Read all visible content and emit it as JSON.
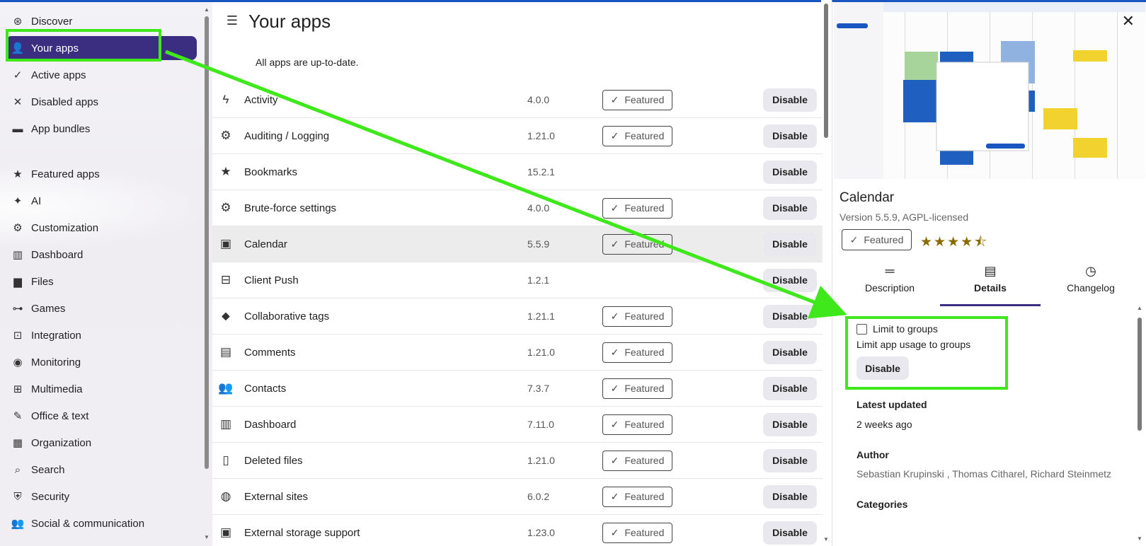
{
  "sidebar": {
    "items": [
      {
        "label": "Discover",
        "icon": "compass-icon",
        "active": false
      },
      {
        "label": "Your apps",
        "icon": "user-icon",
        "active": true
      },
      {
        "label": "Active apps",
        "icon": "check-icon",
        "active": false
      },
      {
        "label": "Disabled apps",
        "icon": "close-icon",
        "active": false
      },
      {
        "label": "App bundles",
        "icon": "archive-icon",
        "active": false
      }
    ],
    "categories": [
      {
        "label": "Featured apps",
        "icon": "star-icon"
      },
      {
        "label": "AI",
        "icon": "sparkle-icon"
      },
      {
        "label": "Customization",
        "icon": "gear-icon"
      },
      {
        "label": "Dashboard",
        "icon": "dashboard-icon"
      },
      {
        "label": "Files",
        "icon": "folder-icon"
      },
      {
        "label": "Games",
        "icon": "gamepad-icon"
      },
      {
        "label": "Integration",
        "icon": "integration-icon"
      },
      {
        "label": "Monitoring",
        "icon": "monitor-icon"
      },
      {
        "label": "Multimedia",
        "icon": "multimedia-icon"
      },
      {
        "label": "Office & text",
        "icon": "document-edit-icon"
      },
      {
        "label": "Organization",
        "icon": "building-icon"
      },
      {
        "label": "Search",
        "icon": "search-icon"
      },
      {
        "label": "Security",
        "icon": "shield-icon"
      },
      {
        "label": "Social & communication",
        "icon": "people-icon"
      }
    ]
  },
  "main": {
    "title": "Your apps",
    "status": "All apps are up-to-date.",
    "featured_label": "Featured",
    "disable_label": "Disable",
    "apps": [
      {
        "name": "Activity",
        "version": "4.0.0",
        "featured": true,
        "icon": "lightning-icon"
      },
      {
        "name": "Auditing / Logging",
        "version": "1.21.0",
        "featured": true,
        "icon": "gear-icon"
      },
      {
        "name": "Bookmarks",
        "version": "15.2.1",
        "featured": false,
        "icon": "star-icon"
      },
      {
        "name": "Brute-force settings",
        "version": "4.0.0",
        "featured": true,
        "icon": "gear-icon"
      },
      {
        "name": "Calendar",
        "version": "5.5.9",
        "featured": true,
        "icon": "calendar-icon",
        "selected": true
      },
      {
        "name": "Client Push",
        "version": "1.2.1",
        "featured": false,
        "icon": "push-icon"
      },
      {
        "name": "Collaborative tags",
        "version": "1.21.1",
        "featured": true,
        "icon": "tag-icon"
      },
      {
        "name": "Comments",
        "version": "1.21.0",
        "featured": true,
        "icon": "comment-icon"
      },
      {
        "name": "Contacts",
        "version": "7.3.7",
        "featured": true,
        "icon": "contacts-icon"
      },
      {
        "name": "Dashboard",
        "version": "7.11.0",
        "featured": true,
        "icon": "dashboard-icon"
      },
      {
        "name": "Deleted files",
        "version": "1.21.0",
        "featured": true,
        "icon": "trash-icon"
      },
      {
        "name": "External sites",
        "version": "6.0.2",
        "featured": true,
        "icon": "globe-icon"
      },
      {
        "name": "External storage support",
        "version": "1.23.0",
        "featured": true,
        "icon": "storage-icon"
      }
    ]
  },
  "details": {
    "app_name": "Calendar",
    "version_line": "Version 5.5.9, AGPL-licensed",
    "featured_label": "Featured",
    "rating": 4.5,
    "tabs": [
      {
        "label": "Description",
        "icon": "text-lines-icon",
        "active": false
      },
      {
        "label": "Details",
        "icon": "document-icon",
        "active": true
      },
      {
        "label": "Changelog",
        "icon": "history-icon",
        "active": false
      }
    ],
    "limit_label": "Limit to groups",
    "limit_hint": "Limit app usage to groups",
    "disable_label": "Disable",
    "updated_heading": "Latest updated",
    "updated_value": "2 weeks ago",
    "author_heading": "Author",
    "author_value": "Sebastian Krupinski , Thomas Citharel, Richard Steinmetz",
    "categories_heading": "Categories"
  },
  "colors": {
    "accent": "#3b2d80",
    "highlight": "#3ee81b",
    "topbar": "#1a56c2"
  }
}
